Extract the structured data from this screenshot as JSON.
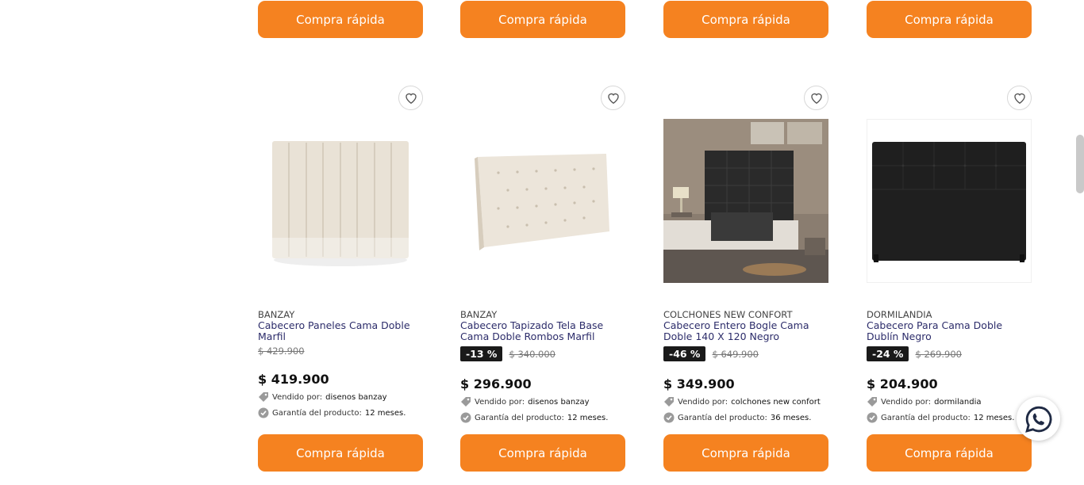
{
  "quick_buy_label": "Compra rápida",
  "meta_labels": {
    "sold_by": "Vendido por:",
    "warranty": "Garantía del producto:"
  },
  "colors": {
    "accent": "#f58220",
    "badge": "#1a1a1a"
  },
  "products": [
    {
      "brand": "BANZAY",
      "name": "Cabecero Paneles Cama Doble Marfil",
      "discount": "",
      "old_price": "$ 429.900",
      "price": "$ 419.900",
      "seller": "disenos banzay",
      "warranty": "12 meses."
    },
    {
      "brand": "BANZAY",
      "name": "Cabecero Tapizado Tela Base Cama Doble Rombos Marfil",
      "discount": "-13 %",
      "old_price": "$ 340.000",
      "price": "$ 296.900",
      "seller": "disenos banzay",
      "warranty": "12 meses."
    },
    {
      "brand": "COLCHONES NEW CONFORT",
      "name": "Cabecero Entero Bogle Cama Doble 140 X 120 Negro",
      "discount": "-46 %",
      "old_price": "$ 649.900",
      "price": "$ 349.900",
      "seller": "colchones new confort",
      "warranty": "36 meses."
    },
    {
      "brand": "DORMILANDIA",
      "name": "Cabecero Para Cama Doble Dublín Negro",
      "discount": "-24 %",
      "old_price": "$ 269.900",
      "price": "$ 204.900",
      "seller": "dormilandia",
      "warranty": "12 meses."
    }
  ]
}
